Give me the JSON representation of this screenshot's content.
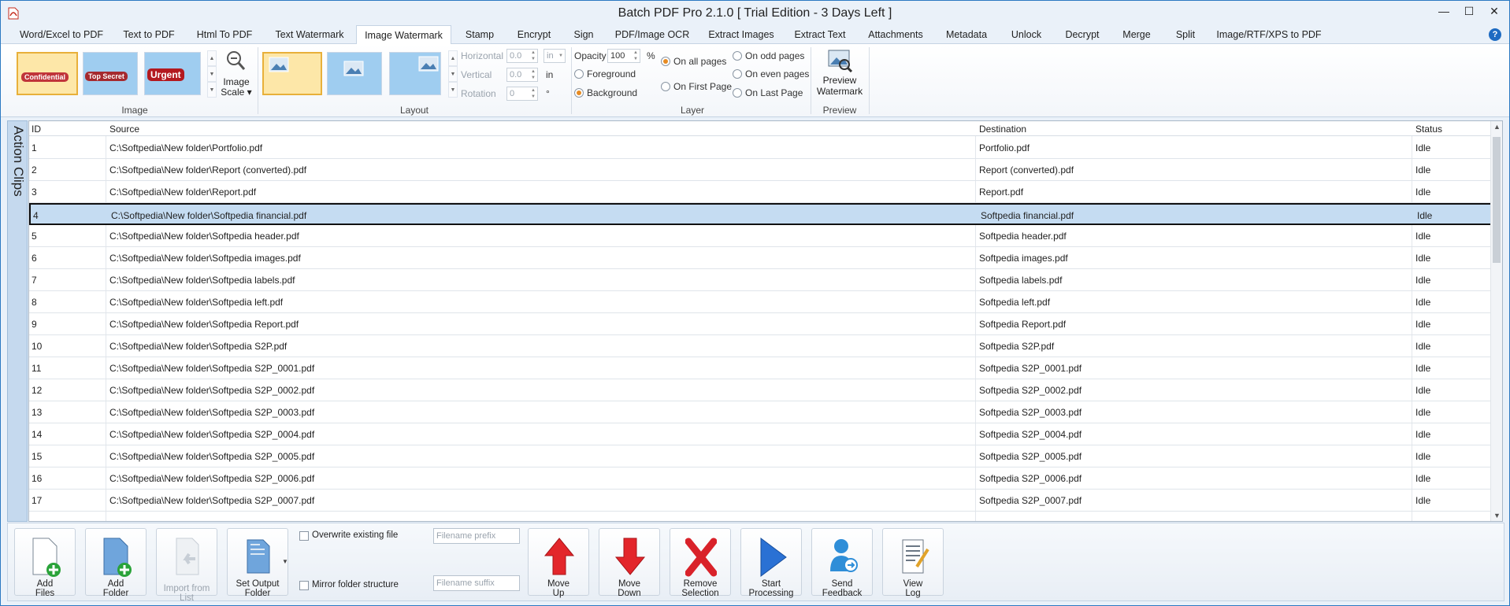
{
  "window": {
    "title": "Batch PDF Pro 2.1.0 [ Trial Edition - 3 Days Left ]"
  },
  "tabs": [
    {
      "label": "Word/Excel to PDF"
    },
    {
      "label": "Text to PDF"
    },
    {
      "label": "Html To PDF"
    },
    {
      "label": "Text Watermark"
    },
    {
      "label": "Image Watermark"
    },
    {
      "label": "Stamp"
    },
    {
      "label": "Encrypt"
    },
    {
      "label": "Sign"
    },
    {
      "label": "PDF/Image OCR"
    },
    {
      "label": "Extract Images"
    },
    {
      "label": "Extract Text"
    },
    {
      "label": "Attachments"
    },
    {
      "label": "Metadata"
    },
    {
      "label": "Unlock"
    },
    {
      "label": "Decrypt"
    },
    {
      "label": "Merge"
    },
    {
      "label": "Split"
    },
    {
      "label": "Image/RTF/XPS to PDF"
    }
  ],
  "active_tab": "Image Watermark",
  "ribbon": {
    "image_group": {
      "label": "Image",
      "presets": [
        "Confidential",
        "Top Secret",
        "Urgent"
      ],
      "scale_label_1": "Image",
      "scale_label_2": "Scale"
    },
    "layout_group": {
      "label": "Layout",
      "horizontal_label": "Horizontal",
      "horizontal_value": "0.0",
      "horizontal_unit": "in",
      "vertical_label": "Vertical",
      "vertical_value": "0.0",
      "vertical_unit": "in",
      "rotation_label": "Rotation",
      "rotation_value": "0",
      "rotation_unit": "°"
    },
    "layer_group": {
      "label": "Layer",
      "opacity_label": "Opacity",
      "opacity_value": "100",
      "opacity_unit": "%",
      "foreground": "Foreground",
      "background": "Background",
      "on_all_pages": "On all pages",
      "on_first_page": "On First Page",
      "on_odd_pages": "On odd pages",
      "on_even_pages": "On even pages",
      "on_last_page": "On Last Page"
    },
    "preview_group": {
      "label": "Preview",
      "button_1": "Preview",
      "button_2": "Watermark"
    }
  },
  "side_panel": {
    "label": "Action Clips"
  },
  "grid": {
    "headers": {
      "id": "ID",
      "source": "Source",
      "destination": "Destination",
      "status": "Status"
    },
    "rows": [
      {
        "id": "1",
        "source": "C:\\Softpedia\\New folder\\Portfolio.pdf",
        "destination": "Portfolio.pdf",
        "status": "Idle"
      },
      {
        "id": "2",
        "source": "C:\\Softpedia\\New folder\\Report (converted).pdf",
        "destination": "Report (converted).pdf",
        "status": "Idle"
      },
      {
        "id": "3",
        "source": "C:\\Softpedia\\New folder\\Report.pdf",
        "destination": "Report.pdf",
        "status": "Idle"
      },
      {
        "id": "4",
        "source": "C:\\Softpedia\\New folder\\Softpedia financial.pdf",
        "destination": "Softpedia financial.pdf",
        "status": "Idle"
      },
      {
        "id": "5",
        "source": "C:\\Softpedia\\New folder\\Softpedia header.pdf",
        "destination": "Softpedia header.pdf",
        "status": "Idle"
      },
      {
        "id": "6",
        "source": "C:\\Softpedia\\New folder\\Softpedia images.pdf",
        "destination": "Softpedia images.pdf",
        "status": "Idle"
      },
      {
        "id": "7",
        "source": "C:\\Softpedia\\New folder\\Softpedia labels.pdf",
        "destination": "Softpedia labels.pdf",
        "status": "Idle"
      },
      {
        "id": "8",
        "source": "C:\\Softpedia\\New folder\\Softpedia left.pdf",
        "destination": "Softpedia left.pdf",
        "status": "Idle"
      },
      {
        "id": "9",
        "source": "C:\\Softpedia\\New folder\\Softpedia Report.pdf",
        "destination": "Softpedia Report.pdf",
        "status": "Idle"
      },
      {
        "id": "10",
        "source": "C:\\Softpedia\\New folder\\Softpedia S2P.pdf",
        "destination": "Softpedia S2P.pdf",
        "status": "Idle"
      },
      {
        "id": "11",
        "source": "C:\\Softpedia\\New folder\\Softpedia S2P_0001.pdf",
        "destination": "Softpedia S2P_0001.pdf",
        "status": "Idle"
      },
      {
        "id": "12",
        "source": "C:\\Softpedia\\New folder\\Softpedia S2P_0002.pdf",
        "destination": "Softpedia S2P_0002.pdf",
        "status": "Idle"
      },
      {
        "id": "13",
        "source": "C:\\Softpedia\\New folder\\Softpedia S2P_0003.pdf",
        "destination": "Softpedia S2P_0003.pdf",
        "status": "Idle"
      },
      {
        "id": "14",
        "source": "C:\\Softpedia\\New folder\\Softpedia S2P_0004.pdf",
        "destination": "Softpedia S2P_0004.pdf",
        "status": "Idle"
      },
      {
        "id": "15",
        "source": "C:\\Softpedia\\New folder\\Softpedia S2P_0005.pdf",
        "destination": "Softpedia S2P_0005.pdf",
        "status": "Idle"
      },
      {
        "id": "16",
        "source": "C:\\Softpedia\\New folder\\Softpedia S2P_0006.pdf",
        "destination": "Softpedia S2P_0006.pdf",
        "status": "Idle"
      },
      {
        "id": "17",
        "source": "C:\\Softpedia\\New folder\\Softpedia S2P_0007.pdf",
        "destination": "Softpedia S2P_0007.pdf",
        "status": "Idle"
      }
    ],
    "selected_row_id": "4"
  },
  "bottom_toolbar": {
    "add_files_1": "Add",
    "add_files_2": "Files",
    "add_folder_1": "Add",
    "add_folder_2": "Folder",
    "import_from_list": "Import from List",
    "set_output_1": "Set Output",
    "set_output_2": "Folder",
    "overwrite_label": "Overwrite existing file",
    "mirror_label": "Mirror folder structure",
    "prefix_placeholder": "Filename prefix",
    "suffix_placeholder": "Filename suffix",
    "move_up_1": "Move",
    "move_up_2": "Up",
    "move_down_1": "Move",
    "move_down_2": "Down",
    "remove_1": "Remove",
    "remove_2": "Selection",
    "start_1": "Start",
    "start_2": "Processing",
    "feedback_1": "Send",
    "feedback_2": "Feedback",
    "log_1": "View",
    "log_2": "Log"
  },
  "colors": {
    "accent": "#3d8fd8",
    "selected_row": "#c5dcf2",
    "move_arrow": "#e3262b",
    "start_arrow": "#2a71d4"
  }
}
